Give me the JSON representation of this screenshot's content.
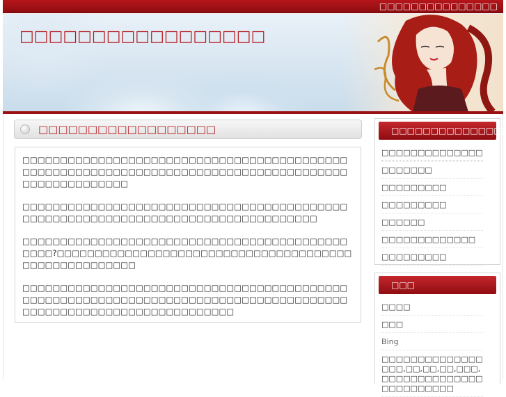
{
  "topbar": {
    "link_text": "□□□□□□□□□□□□□□□"
  },
  "header": {
    "site_title": "□□□□□□□□□□□□□□□□□"
  },
  "post": {
    "title": "□□□□□□□□□□□□□□□□□□",
    "paragraphs": [
      "□□□□□□□□□□□□□□□□□□□□□□□□□□□□□□□□□□□□□□□□□□□□□□□□□□□□□□□□□□□□□□□□□□□□□□□□□□□□□□□□□□□□□□□□□□□□□□□□□□□□",
      "□□□□□□□□□□□□□□□□□□□□□□□□□□□□□□□□□□□□□□□□□□□□□□□□□□□□□□□□□□□□□□□□□□□□□□□□□□□□□□□□□□",
      "□□□□□□□□□□□□□□□□□□□□□□□□□□□□□□□□□□□□□□□□□□□□□□□?□□□□□□□□□□□□□□□□□□□□□□□□□□□□□□□□□□□□□□□□□□□□□□□□□□□□□□",
      "□□□□□□□□□□□□□□□□□□□□□□□□□□□□□□□□□□□□□□□□□□□□□□□□□□□□□□□□□□□□□□□□□□□□□□□□□□□□□□□□□□□□□□□□□□□□□□□□□□□□□□□□□□□□□□□□□□"
    ]
  },
  "sidebar": {
    "box1": {
      "heading": "□□□□□□□□□□□□□□□□□",
      "items": [
        "□□□□□□□□□□□□□□",
        "□□□□□□□",
        "□□□□□□□□□",
        "□□□□□□□□□",
        "□□□□□□",
        "□□□□□□□□□□□□□",
        "□□□□□□□□□"
      ]
    },
    "box2": {
      "heading": "□□□",
      "items": [
        "□□□□",
        "□□□",
        "Bing",
        "□□□□□□□□□□□□□□□□□,□□,□□,□□,□□□,□□□□□□□□□□□□□□□□□□□□□□□□"
      ]
    }
  },
  "colors": {
    "accent": "#b5161b",
    "dark_red": "#8e0c10"
  }
}
